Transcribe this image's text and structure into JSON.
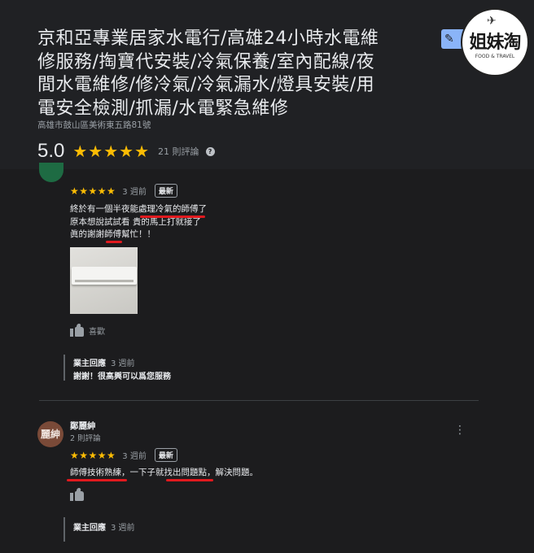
{
  "business": {
    "title": "京和亞專業居家水電行/高雄24小時水電維修服務/掏寶代安裝/冷氣保養/室內配線/夜間水電維修/修冷氣/冷氣漏水/燈具安裝/用電安全檢測/抓漏/水電緊急維修",
    "address": "高雄市鼓山區美術東五路81號",
    "rating": "5.0",
    "stars": "★★★★★",
    "review_count": "21 則評論",
    "help_symbol": "?"
  },
  "edit_button": {
    "icon": "pencil-icon",
    "symbol": "✎"
  },
  "watermark": {
    "text": "姐妹淘",
    "subtitle": "FOOD & TRAVEL",
    "plane": "✈"
  },
  "reviews": [
    {
      "stars": "★★★★★",
      "time": "3 週前",
      "badge": "最新",
      "lines": [
        "終於有一個半夜能處理冷氣的師傅了",
        "原本想說試試看 貴的馬上打就接了",
        "眞的謝謝師傅幫忙！！"
      ],
      "like_label": "喜歡",
      "owner": {
        "label": "業主回應",
        "time": "3 週前",
        "reply": "謝謝！很高興可以爲您服務"
      }
    },
    {
      "avatar": "麗紳",
      "name": "鄭麗紳",
      "sub": "2 則評論",
      "stars": "★★★★★",
      "time": "3 週前",
      "badge": "最新",
      "line": "師傅技術熟練，一下子就找出問題點，解決問題。",
      "like_label": "喜歡",
      "owner": {
        "label": "業主回應",
        "time": "3 週前"
      },
      "more": "⋮"
    }
  ],
  "colors": {
    "star": "#fbbc04",
    "accent_edit": "#8ab4f8",
    "highlight": "#e0191e"
  }
}
